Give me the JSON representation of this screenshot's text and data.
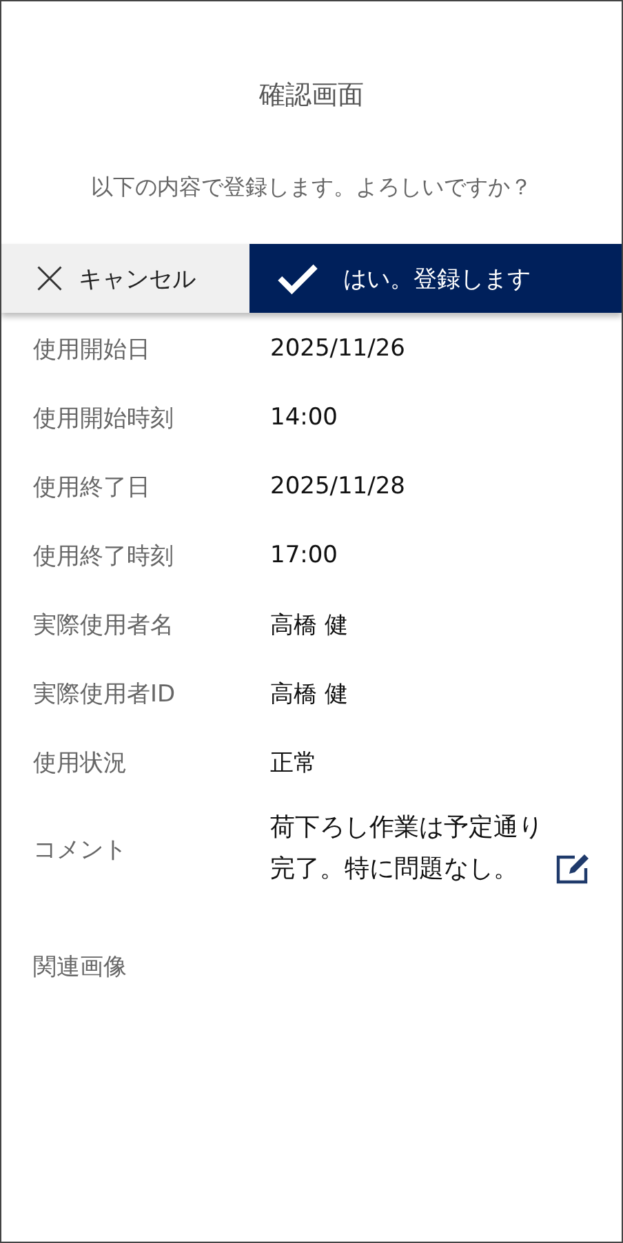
{
  "title": "確認画面",
  "prompt": "以下の内容で登録します。よろしいですか？",
  "buttons": [
    {
      "kind": "cancel",
      "label": "キャンセル"
    },
    {
      "kind": "confirm",
      "label": "はい。登録します"
    }
  ],
  "fields": [
    {
      "kind": "text",
      "label": "使用開始日",
      "value": "2025/11/26"
    },
    {
      "kind": "text",
      "label": "使用開始時刻",
      "value": "14:00"
    },
    {
      "kind": "text",
      "label": "使用終了日",
      "value": "2025/11/28"
    },
    {
      "kind": "text",
      "label": "使用終了時刻",
      "value": "17:00"
    },
    {
      "kind": "text",
      "label": "実際使用者名",
      "value": "高橋 健"
    },
    {
      "kind": "text",
      "label": "実際使用者ID",
      "value": "高橋 健"
    },
    {
      "kind": "text",
      "label": "使用状況",
      "value": "正常"
    },
    {
      "kind": "comment",
      "label": "コメント",
      "value": "荷下ろし作業は予定通り完了。特に問題なし。"
    },
    {
      "kind": "images",
      "label": "関連画像"
    }
  ]
}
